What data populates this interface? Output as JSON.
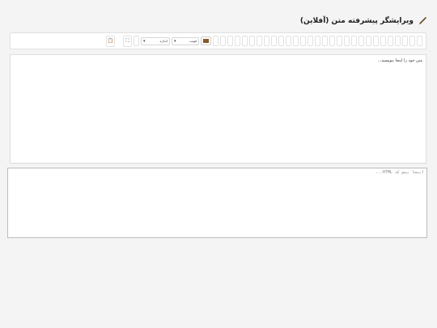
{
  "header": {
    "title": "ویرایشگر پیشرفته متن (آفلاین)",
    "icon": "brush-icon"
  },
  "toolbar": {
    "color_icon": "text-color-icon",
    "font_select": {
      "selected": "فونت"
    },
    "size_select": {
      "selected": "اندازه"
    },
    "fullscreen_icon": "fullscreen-icon",
    "clipboard_icon": "clipboard-icon"
  },
  "editor": {
    "placeholder": "متن خود را اینجا بنویسید..."
  },
  "html_source": {
    "placeholder": "اینجا پیش کد HTML..."
  }
}
